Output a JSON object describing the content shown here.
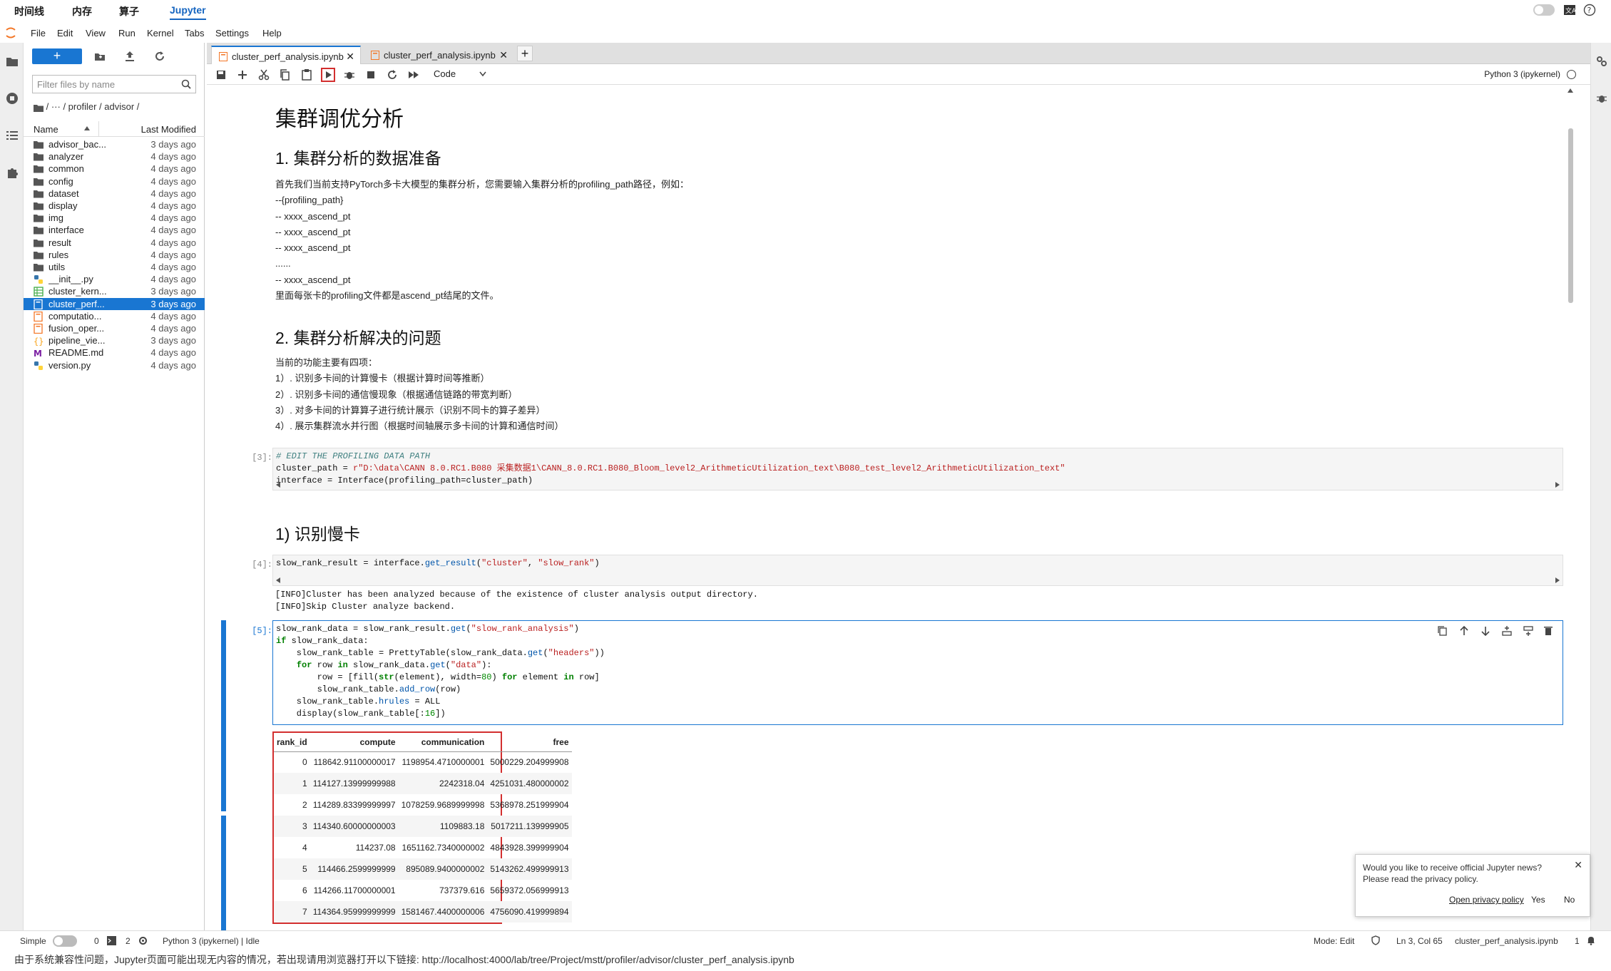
{
  "topnav": {
    "tabs": [
      "时间线",
      "内存",
      "算子",
      "Jupyter"
    ],
    "active": "Jupyter"
  },
  "menu": [
    "File",
    "Edit",
    "View",
    "Run",
    "Kernel",
    "Tabs",
    "Settings",
    "Help"
  ],
  "filebrowser": {
    "new_label": "+",
    "filter_placeholder": "Filter files by name",
    "breadcrumb": "/   ···   / profiler / advisor /",
    "col_name": "Name",
    "col_modified": "Last Modified",
    "files": [
      {
        "name": "advisor_bac...",
        "modified": "3 days ago",
        "type": "folder"
      },
      {
        "name": "analyzer",
        "modified": "4 days ago",
        "type": "folder"
      },
      {
        "name": "common",
        "modified": "4 days ago",
        "type": "folder"
      },
      {
        "name": "config",
        "modified": "4 days ago",
        "type": "folder"
      },
      {
        "name": "dataset",
        "modified": "4 days ago",
        "type": "folder"
      },
      {
        "name": "display",
        "modified": "4 days ago",
        "type": "folder"
      },
      {
        "name": "img",
        "modified": "4 days ago",
        "type": "folder"
      },
      {
        "name": "interface",
        "modified": "4 days ago",
        "type": "folder"
      },
      {
        "name": "result",
        "modified": "4 days ago",
        "type": "folder"
      },
      {
        "name": "rules",
        "modified": "4 days ago",
        "type": "folder"
      },
      {
        "name": "utils",
        "modified": "4 days ago",
        "type": "folder"
      },
      {
        "name": "__init__.py",
        "modified": "4 days ago",
        "type": "python"
      },
      {
        "name": "cluster_kern...",
        "modified": "3 days ago",
        "type": "table"
      },
      {
        "name": "cluster_perf...",
        "modified": "3 days ago",
        "type": "notebook",
        "selected": true
      },
      {
        "name": "computatio...",
        "modified": "4 days ago",
        "type": "notebook"
      },
      {
        "name": "fusion_oper...",
        "modified": "4 days ago",
        "type": "notebook"
      },
      {
        "name": "pipeline_vie...",
        "modified": "3 days ago",
        "type": "json"
      },
      {
        "name": "README.md",
        "modified": "4 days ago",
        "type": "markdown"
      },
      {
        "name": "version.py",
        "modified": "4 days ago",
        "type": "python"
      }
    ]
  },
  "tabs": [
    {
      "label": "cluster_perf_analysis.ipynb",
      "active": true
    },
    {
      "label": "cluster_perf_analysis.ipynb",
      "active": false
    }
  ],
  "toolbar": {
    "cell_type": "Code",
    "kernel": "Python 3 (ipykernel)"
  },
  "notebook": {
    "title": "集群调优分析",
    "h_1": "1. 集群分析的数据准备",
    "p_1": "首先我们当前支持PyTorch多卡大模型的集群分析，您需要输入集群分析的profiling_path路径，例如：\n--{profiling_path}\n-- xxxx_ascend_pt\n-- xxxx_ascend_pt\n-- xxxx_ascend_pt\n......\n-- xxxx_ascend_pt\n里面每张卡的profiling文件都是ascend_pt结尾的文件。",
    "h_2": "2. 集群分析解决的问题",
    "p_2": "当前的功能主要有四项：\n1）. 识别多卡间的计算慢卡（根据计算时间等推断）\n2）. 识别多卡间的通信慢现象（根据通信链路的带宽判断）\n3）. 对多卡间的计算算子进行统计展示（识别不同卡的算子差异）\n4）. 展示集群流水并行图（根据时间轴展示多卡间的计算和通信时间）",
    "prompt_3": "[3]:",
    "code_3_comment": "# EDIT THE PROFILING DATA PATH",
    "code_3_line2_a": "cluster_path = ",
    "code_3_line2_b": "r\"D:\\data\\CANN 8.0.RC1.B080 采集数据1\\CANN_8.0.RC1.B080_Bloom_level2_ArithmeticUtilization_text\\B080_test_level2_ArithmeticUtilization_text\"",
    "code_3_line3": "interface = Interface(profiling_path=cluster_path)",
    "h_3": "1) 识别慢卡",
    "prompt_4": "[4]:",
    "code_4_a": "slow_rank_result = interface.",
    "code_4_b": "get_result",
    "code_4_c": "(",
    "code_4_d": "\"cluster\"",
    "code_4_e": ", ",
    "code_4_f": "\"slow_rank\"",
    "code_4_g": ")",
    "output_4": "[INFO]Cluster has been analyzed because of the existence of cluster analysis output directory.\n[INFO]Skip Cluster analyze backend.",
    "prompt_5": "[5]:",
    "rank_table": {
      "headers": [
        "rank_id",
        "compute",
        "communication",
        "free"
      ],
      "rows": [
        [
          "0",
          "118642.91100000017",
          "1198954.4710000001",
          "5000229.204999908"
        ],
        [
          "1",
          "114127.13999999988",
          "2242318.04",
          "4251031.480000002"
        ],
        [
          "2",
          "114289.83399999997",
          "1078259.9689999998",
          "5368978.251999904"
        ],
        [
          "3",
          "114340.60000000003",
          "1109883.18",
          "5017211.139999905"
        ],
        [
          "4",
          "114237.08",
          "1651162.7340000002",
          "4843928.399999904"
        ],
        [
          "5",
          "114466.2599999999",
          "895089.9400000002",
          "5143262.499999913"
        ],
        [
          "6",
          "114266.11700000001",
          "737379.616",
          "5659372.056999913"
        ],
        [
          "7",
          "114364.95999999999",
          "1581467.4400000006",
          "4756090.419999894"
        ]
      ]
    }
  },
  "notification": {
    "line1": "Would you like to receive official Jupyter news?",
    "line2": "Please read the privacy policy.",
    "link": "Open privacy policy",
    "yes": "Yes",
    "no": "No"
  },
  "statusbar": {
    "mode_label": "Simple",
    "count_a": "0",
    "count_b": "2",
    "kernel_status": "Python 3 (ipykernel) | Idle",
    "edit_mode": "Mode: Edit",
    "cursor": "Ln 3, Col 65",
    "filename": "cluster_perf_analysis.ipynb",
    "notif_count": "1"
  },
  "footer_note": "由于系统兼容性问题，Jupyter页面可能出现无内容的情况，若出现请用浏览器打开以下链接: http://localhost:4000/lab/tree/Project/mstt/profiler/advisor/cluster_perf_analysis.ipynb",
  "colors": {
    "accent": "#1976d2",
    "highlight_red": "#d32f2f",
    "jupyter_orange": "#f37626"
  }
}
